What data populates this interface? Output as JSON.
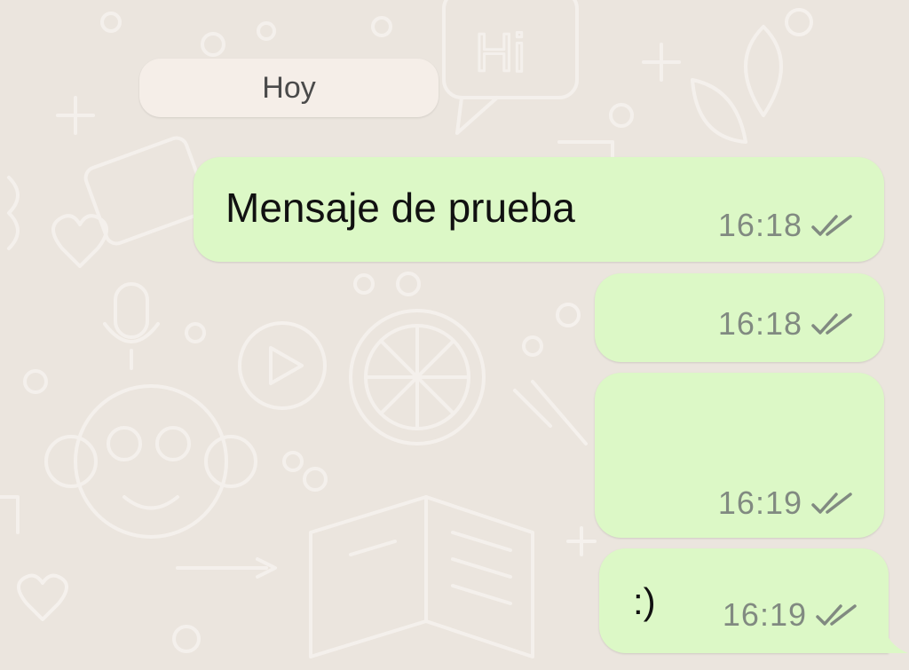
{
  "chat": {
    "day_separator": "Hoy",
    "messages": [
      {
        "text": "Mensaje de prueba",
        "time": "16:18",
        "status": "read-ticks-icon"
      },
      {
        "text": "",
        "time": "16:18",
        "status": "read-ticks-icon"
      },
      {
        "text": "",
        "time": "16:19",
        "status": "read-ticks-icon"
      },
      {
        "text": ":)",
        "time": "16:19",
        "status": "read-ticks-icon"
      }
    ]
  },
  "colors": {
    "wallpaper": "#ebe5de",
    "outgoing_bubble": "#dcf8c6",
    "day_chip": "#f5eee8",
    "timestamp": "#818a81"
  }
}
